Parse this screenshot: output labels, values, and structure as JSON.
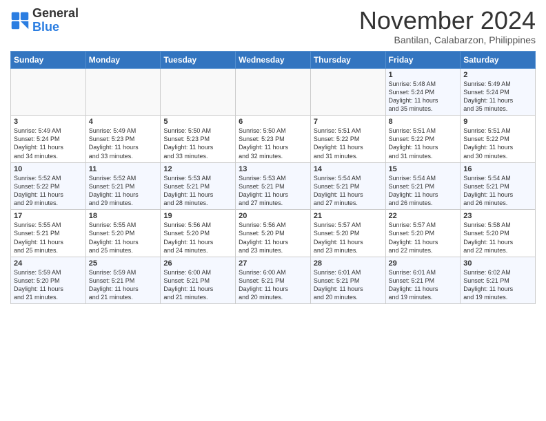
{
  "logo": {
    "general": "General",
    "blue": "Blue"
  },
  "header": {
    "month": "November 2024",
    "location": "Bantilan, Calabarzon, Philippines"
  },
  "days_of_week": [
    "Sunday",
    "Monday",
    "Tuesday",
    "Wednesday",
    "Thursday",
    "Friday",
    "Saturday"
  ],
  "weeks": [
    [
      {
        "day": "",
        "info": ""
      },
      {
        "day": "",
        "info": ""
      },
      {
        "day": "",
        "info": ""
      },
      {
        "day": "",
        "info": ""
      },
      {
        "day": "",
        "info": ""
      },
      {
        "day": "1",
        "info": "Sunrise: 5:48 AM\nSunset: 5:24 PM\nDaylight: 11 hours\nand 35 minutes."
      },
      {
        "day": "2",
        "info": "Sunrise: 5:49 AM\nSunset: 5:24 PM\nDaylight: 11 hours\nand 35 minutes."
      }
    ],
    [
      {
        "day": "3",
        "info": "Sunrise: 5:49 AM\nSunset: 5:24 PM\nDaylight: 11 hours\nand 34 minutes."
      },
      {
        "day": "4",
        "info": "Sunrise: 5:49 AM\nSunset: 5:23 PM\nDaylight: 11 hours\nand 33 minutes."
      },
      {
        "day": "5",
        "info": "Sunrise: 5:50 AM\nSunset: 5:23 PM\nDaylight: 11 hours\nand 33 minutes."
      },
      {
        "day": "6",
        "info": "Sunrise: 5:50 AM\nSunset: 5:23 PM\nDaylight: 11 hours\nand 32 minutes."
      },
      {
        "day": "7",
        "info": "Sunrise: 5:51 AM\nSunset: 5:22 PM\nDaylight: 11 hours\nand 31 minutes."
      },
      {
        "day": "8",
        "info": "Sunrise: 5:51 AM\nSunset: 5:22 PM\nDaylight: 11 hours\nand 31 minutes."
      },
      {
        "day": "9",
        "info": "Sunrise: 5:51 AM\nSunset: 5:22 PM\nDaylight: 11 hours\nand 30 minutes."
      }
    ],
    [
      {
        "day": "10",
        "info": "Sunrise: 5:52 AM\nSunset: 5:22 PM\nDaylight: 11 hours\nand 29 minutes."
      },
      {
        "day": "11",
        "info": "Sunrise: 5:52 AM\nSunset: 5:21 PM\nDaylight: 11 hours\nand 29 minutes."
      },
      {
        "day": "12",
        "info": "Sunrise: 5:53 AM\nSunset: 5:21 PM\nDaylight: 11 hours\nand 28 minutes."
      },
      {
        "day": "13",
        "info": "Sunrise: 5:53 AM\nSunset: 5:21 PM\nDaylight: 11 hours\nand 27 minutes."
      },
      {
        "day": "14",
        "info": "Sunrise: 5:54 AM\nSunset: 5:21 PM\nDaylight: 11 hours\nand 27 minutes."
      },
      {
        "day": "15",
        "info": "Sunrise: 5:54 AM\nSunset: 5:21 PM\nDaylight: 11 hours\nand 26 minutes."
      },
      {
        "day": "16",
        "info": "Sunrise: 5:54 AM\nSunset: 5:21 PM\nDaylight: 11 hours\nand 26 minutes."
      }
    ],
    [
      {
        "day": "17",
        "info": "Sunrise: 5:55 AM\nSunset: 5:21 PM\nDaylight: 11 hours\nand 25 minutes."
      },
      {
        "day": "18",
        "info": "Sunrise: 5:55 AM\nSunset: 5:20 PM\nDaylight: 11 hours\nand 25 minutes."
      },
      {
        "day": "19",
        "info": "Sunrise: 5:56 AM\nSunset: 5:20 PM\nDaylight: 11 hours\nand 24 minutes."
      },
      {
        "day": "20",
        "info": "Sunrise: 5:56 AM\nSunset: 5:20 PM\nDaylight: 11 hours\nand 23 minutes."
      },
      {
        "day": "21",
        "info": "Sunrise: 5:57 AM\nSunset: 5:20 PM\nDaylight: 11 hours\nand 23 minutes."
      },
      {
        "day": "22",
        "info": "Sunrise: 5:57 AM\nSunset: 5:20 PM\nDaylight: 11 hours\nand 22 minutes."
      },
      {
        "day": "23",
        "info": "Sunrise: 5:58 AM\nSunset: 5:20 PM\nDaylight: 11 hours\nand 22 minutes."
      }
    ],
    [
      {
        "day": "24",
        "info": "Sunrise: 5:59 AM\nSunset: 5:20 PM\nDaylight: 11 hours\nand 21 minutes."
      },
      {
        "day": "25",
        "info": "Sunrise: 5:59 AM\nSunset: 5:21 PM\nDaylight: 11 hours\nand 21 minutes."
      },
      {
        "day": "26",
        "info": "Sunrise: 6:00 AM\nSunset: 5:21 PM\nDaylight: 11 hours\nand 21 minutes."
      },
      {
        "day": "27",
        "info": "Sunrise: 6:00 AM\nSunset: 5:21 PM\nDaylight: 11 hours\nand 20 minutes."
      },
      {
        "day": "28",
        "info": "Sunrise: 6:01 AM\nSunset: 5:21 PM\nDaylight: 11 hours\nand 20 minutes."
      },
      {
        "day": "29",
        "info": "Sunrise: 6:01 AM\nSunset: 5:21 PM\nDaylight: 11 hours\nand 19 minutes."
      },
      {
        "day": "30",
        "info": "Sunrise: 6:02 AM\nSunset: 5:21 PM\nDaylight: 11 hours\nand 19 minutes."
      }
    ]
  ]
}
